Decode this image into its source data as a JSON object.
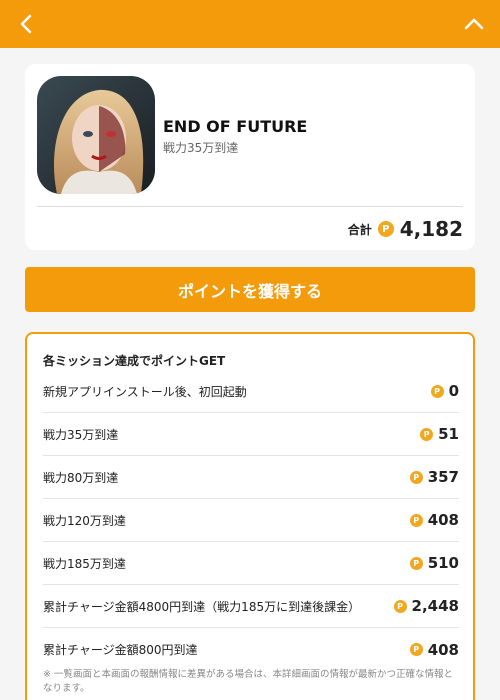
{
  "header": {
    "back_icon": "chevron-left-icon",
    "collapse_icon": "chevron-up-icon",
    "accent_color": "#f49b0b"
  },
  "app": {
    "title": "END OF FUTURE",
    "subtitle": "戦力35万到達",
    "icon": "game-app-icon"
  },
  "total": {
    "label": "合計",
    "coin_symbol": "P",
    "value": "4,182"
  },
  "cta": {
    "label": "ポイントを獲得する"
  },
  "missions": {
    "title": "各ミッション達成でポイントGET",
    "items": [
      {
        "label": "新規アプリインストール後、初回起動",
        "points": "0"
      },
      {
        "label": "戦力35万到達",
        "points": "51"
      },
      {
        "label": "戦力80万到達",
        "points": "357"
      },
      {
        "label": "戦力120万到達",
        "points": "408"
      },
      {
        "label": "戦力185万到達",
        "points": "510"
      },
      {
        "label": "累計チャージ金額4800円到達（戦力185万に到達後課金）",
        "points": "2,448"
      },
      {
        "label": "累計チャージ金額800円到達",
        "points": "408"
      }
    ],
    "footnote": "※ 一覧画面と本画面の報酬情報に差異がある場合は、本詳細画面の情報が最新かつ正確な情報となります。"
  }
}
